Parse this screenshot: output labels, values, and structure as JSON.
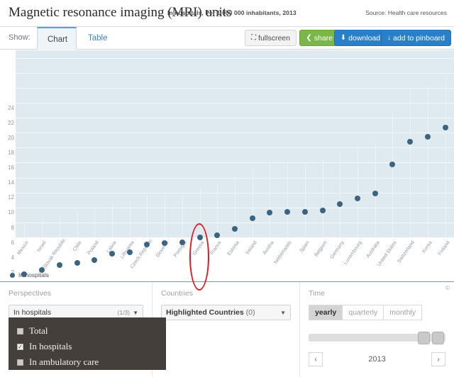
{
  "header": {
    "title": "Magnetic resonance imaging (MRI) units",
    "subtitle": "In hospitals, Per 1 000 000 inhabitants, 2013",
    "source": "Source: Health care resources"
  },
  "toolbar": {
    "show_label": "Show:",
    "tab_chart": "Chart",
    "tab_table": "Table",
    "fullscreen": "fullscreen",
    "share": "share",
    "download": "download",
    "pinboard": "add to pinboard",
    "caret": "▼",
    "fullscreen_icon": "⛶",
    "share_icon": "❮",
    "download_icon": "⬇",
    "pin_icon": "↓"
  },
  "legend": {
    "label": "In hospitals"
  },
  "panels": {
    "perspectives": {
      "title": "Perspectives",
      "selected": "In hospitals",
      "fraction": "(1/3)",
      "caret": "▼",
      "options": [
        {
          "label": "Total",
          "checked": false
        },
        {
          "label": "In hospitals",
          "checked": true
        },
        {
          "label": "In ambulatory care",
          "checked": false
        }
      ]
    },
    "countries": {
      "title": "Countries",
      "selected": "Highlighted Countries",
      "count": "(0)",
      "caret": "▼"
    },
    "time": {
      "title": "Time",
      "granularity": [
        {
          "label": "yearly",
          "active": true
        },
        {
          "label": "quarterly",
          "active": false
        },
        {
          "label": "monthly",
          "active": false
        }
      ],
      "year": "2013",
      "prev": "‹",
      "next": "›",
      "copyright": "©"
    }
  },
  "chart_data": {
    "type": "scatter",
    "title": "Magnetic resonance imaging (MRI) units",
    "subtitle": "In hospitals, Per 1 000 000 inhabitants, 2013",
    "xlabel": "",
    "ylabel": "",
    "ylim": [
      0,
      25
    ],
    "yticks": [
      2,
      4,
      6,
      8,
      10,
      12,
      14,
      16,
      18,
      20,
      22,
      24
    ],
    "grid": true,
    "legend_position": "bottom-left",
    "series_name": "In hospitals",
    "series_color": "#3b6480",
    "annotation": {
      "type": "ellipse",
      "target": "Greece",
      "color": "#e01b22"
    },
    "categories": [
      "Mexico",
      "Israel",
      "Slovak Republic",
      "Chile",
      "Poland",
      "Latvia",
      "Lithuania",
      "Czech Republic",
      "Slovenia",
      "Portugal",
      "Greece",
      "France",
      "Estonia",
      "Ireland",
      "Austria",
      "Netherlands",
      "Spain",
      "Belgium",
      "Germany",
      "Luxembourg",
      "Australia",
      "United States",
      "Switzerland",
      "Korea",
      "Finland"
    ],
    "values": [
      1.8,
      2.4,
      3.0,
      3.3,
      3.7,
      4.5,
      4.7,
      5.8,
      6.0,
      6.1,
      6.7,
      7.0,
      7.9,
      9.3,
      10.0,
      10.1,
      10.1,
      10.3,
      11.2,
      11.9,
      12.6,
      16.5,
      19.5,
      20.2,
      21.4
    ]
  }
}
